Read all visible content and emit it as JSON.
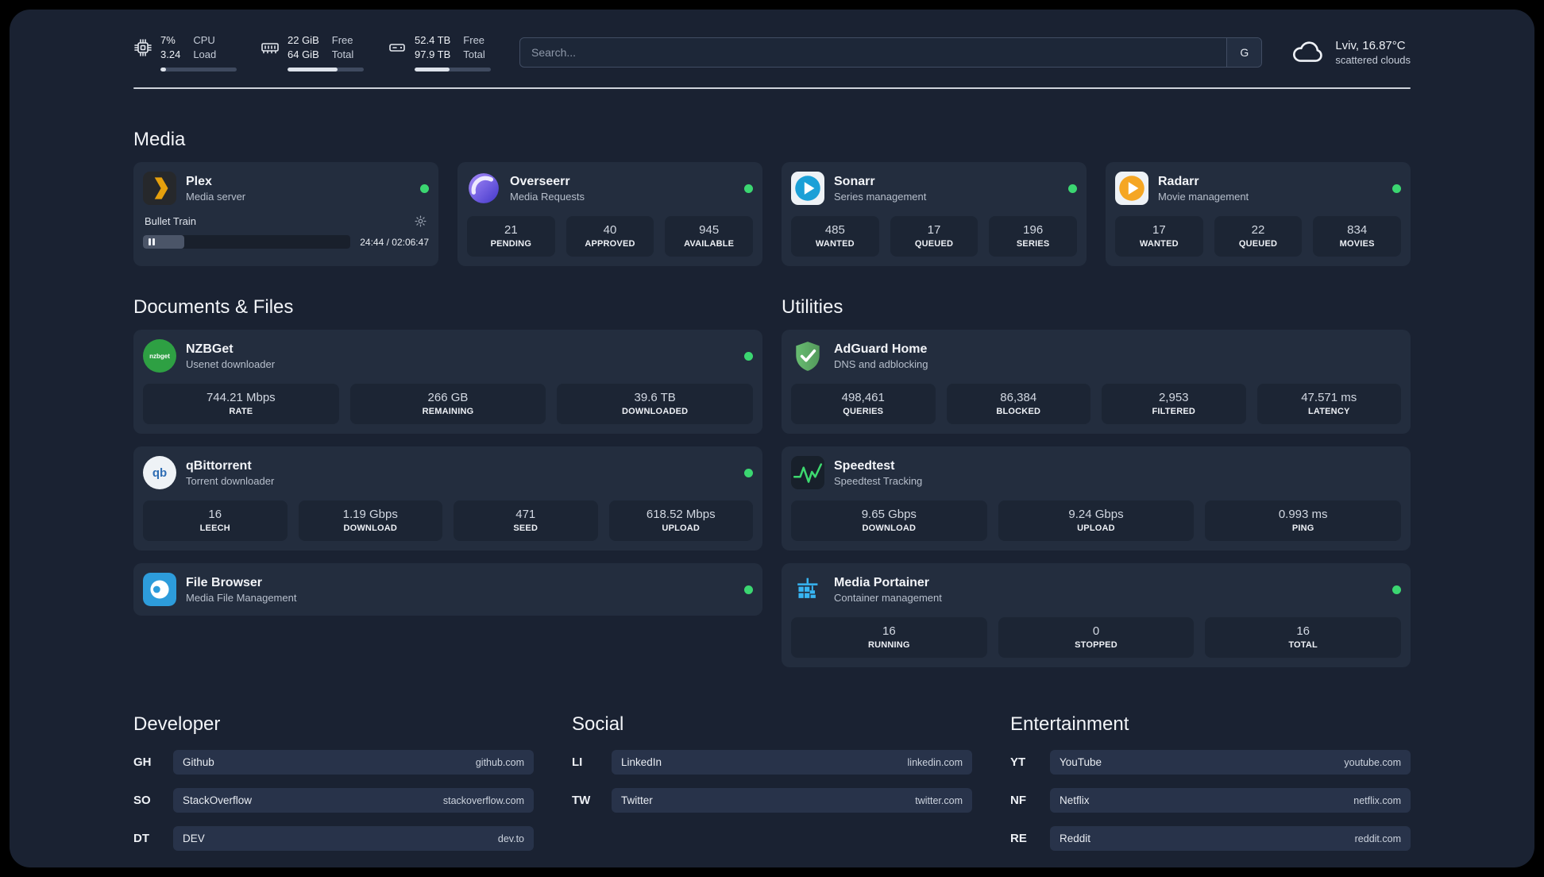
{
  "topbar": {
    "cpu": {
      "values": [
        "7%",
        "3.24"
      ],
      "labels": [
        "CPU",
        "Load"
      ],
      "bar_percent": 7
    },
    "ram": {
      "values": [
        "22 GiB",
        "64 GiB"
      ],
      "labels": [
        "Free",
        "Total"
      ],
      "bar_percent": 66
    },
    "disk": {
      "values": [
        "52.4 TB",
        "97.9 TB"
      ],
      "labels": [
        "Free",
        "Total"
      ],
      "bar_percent": 46
    },
    "search": {
      "placeholder": "Search...",
      "engine_label": "G"
    },
    "weather": {
      "location": "Lviv, 16.87°C",
      "condition": "scattered clouds"
    }
  },
  "sections": {
    "media": {
      "title": "Media",
      "plex": {
        "name": "Plex",
        "subtitle": "Media server",
        "now_playing": {
          "title": "Bullet Train",
          "time": "24:44 / 02:06:47",
          "progress_percent": 20
        }
      },
      "overseerr": {
        "name": "Overseerr",
        "subtitle": "Media Requests",
        "stats": [
          {
            "value": "21",
            "label": "PENDING"
          },
          {
            "value": "40",
            "label": "APPROVED"
          },
          {
            "value": "945",
            "label": "AVAILABLE"
          }
        ]
      },
      "sonarr": {
        "name": "Sonarr",
        "subtitle": "Series management",
        "stats": [
          {
            "value": "485",
            "label": "WANTED"
          },
          {
            "value": "17",
            "label": "QUEUED"
          },
          {
            "value": "196",
            "label": "SERIES"
          }
        ]
      },
      "radarr": {
        "name": "Radarr",
        "subtitle": "Movie management",
        "stats": [
          {
            "value": "17",
            "label": "WANTED"
          },
          {
            "value": "22",
            "label": "QUEUED"
          },
          {
            "value": "834",
            "label": "MOVIES"
          }
        ]
      }
    },
    "documents": {
      "title": "Documents & Files",
      "nzbget": {
        "name": "NZBGet",
        "subtitle": "Usenet downloader",
        "stats": [
          {
            "value": "744.21 Mbps",
            "label": "RATE"
          },
          {
            "value": "266 GB",
            "label": "REMAINING"
          },
          {
            "value": "39.6 TB",
            "label": "DOWNLOADED"
          }
        ]
      },
      "qbittorrent": {
        "name": "qBittorrent",
        "subtitle": "Torrent downloader",
        "stats": [
          {
            "value": "16",
            "label": "LEECH"
          },
          {
            "value": "1.19 Gbps",
            "label": "DOWNLOAD"
          },
          {
            "value": "471",
            "label": "SEED"
          },
          {
            "value": "618.52 Mbps",
            "label": "UPLOAD"
          }
        ]
      },
      "filebrowser": {
        "name": "File Browser",
        "subtitle": "Media File Management"
      }
    },
    "utilities": {
      "title": "Utilities",
      "adguard": {
        "name": "AdGuard Home",
        "subtitle": "DNS and adblocking",
        "stats": [
          {
            "value": "498,461",
            "label": "QUERIES"
          },
          {
            "value": "86,384",
            "label": "BLOCKED"
          },
          {
            "value": "2,953",
            "label": "FILTERED"
          },
          {
            "value": "47.571 ms",
            "label": "LATENCY"
          }
        ]
      },
      "speedtest": {
        "name": "Speedtest",
        "subtitle": "Speedtest Tracking",
        "stats": [
          {
            "value": "9.65 Gbps",
            "label": "DOWNLOAD"
          },
          {
            "value": "9.24 Gbps",
            "label": "UPLOAD"
          },
          {
            "value": "0.993 ms",
            "label": "PING"
          }
        ]
      },
      "portainer": {
        "name": "Media Portainer",
        "subtitle": "Container management",
        "stats": [
          {
            "value": "16",
            "label": "RUNNING"
          },
          {
            "value": "0",
            "label": "STOPPED"
          },
          {
            "value": "16",
            "label": "TOTAL"
          }
        ]
      }
    },
    "bookmarks": {
      "developer": {
        "title": "Developer",
        "items": [
          {
            "abbr": "GH",
            "name": "Github",
            "url": "github.com"
          },
          {
            "abbr": "SO",
            "name": "StackOverflow",
            "url": "stackoverflow.com"
          },
          {
            "abbr": "DT",
            "name": "DEV",
            "url": "dev.to"
          }
        ]
      },
      "social": {
        "title": "Social",
        "items": [
          {
            "abbr": "LI",
            "name": "LinkedIn",
            "url": "linkedin.com"
          },
          {
            "abbr": "TW",
            "name": "Twitter",
            "url": "twitter.com"
          }
        ]
      },
      "entertainment": {
        "title": "Entertainment",
        "items": [
          {
            "abbr": "YT",
            "name": "YouTube",
            "url": "youtube.com"
          },
          {
            "abbr": "NF",
            "name": "Netflix",
            "url": "netflix.com"
          },
          {
            "abbr": "RE",
            "name": "Reddit",
            "url": "reddit.com"
          }
        ]
      }
    }
  },
  "icons": {
    "nzbget_text": "nzbget",
    "qbittorrent_text": "qb"
  },
  "colors": {
    "status_online": "#3bd671",
    "plex_gold": "#e5a00d",
    "sonarr_blue": "#1ba0d7",
    "radarr_orange": "#f5a623",
    "adguard_green": "#68bc71",
    "speedtest_green": "#3dd96f",
    "portainer_blue": "#37b5f3",
    "filebrowser_blue": "#2d9cdb"
  }
}
